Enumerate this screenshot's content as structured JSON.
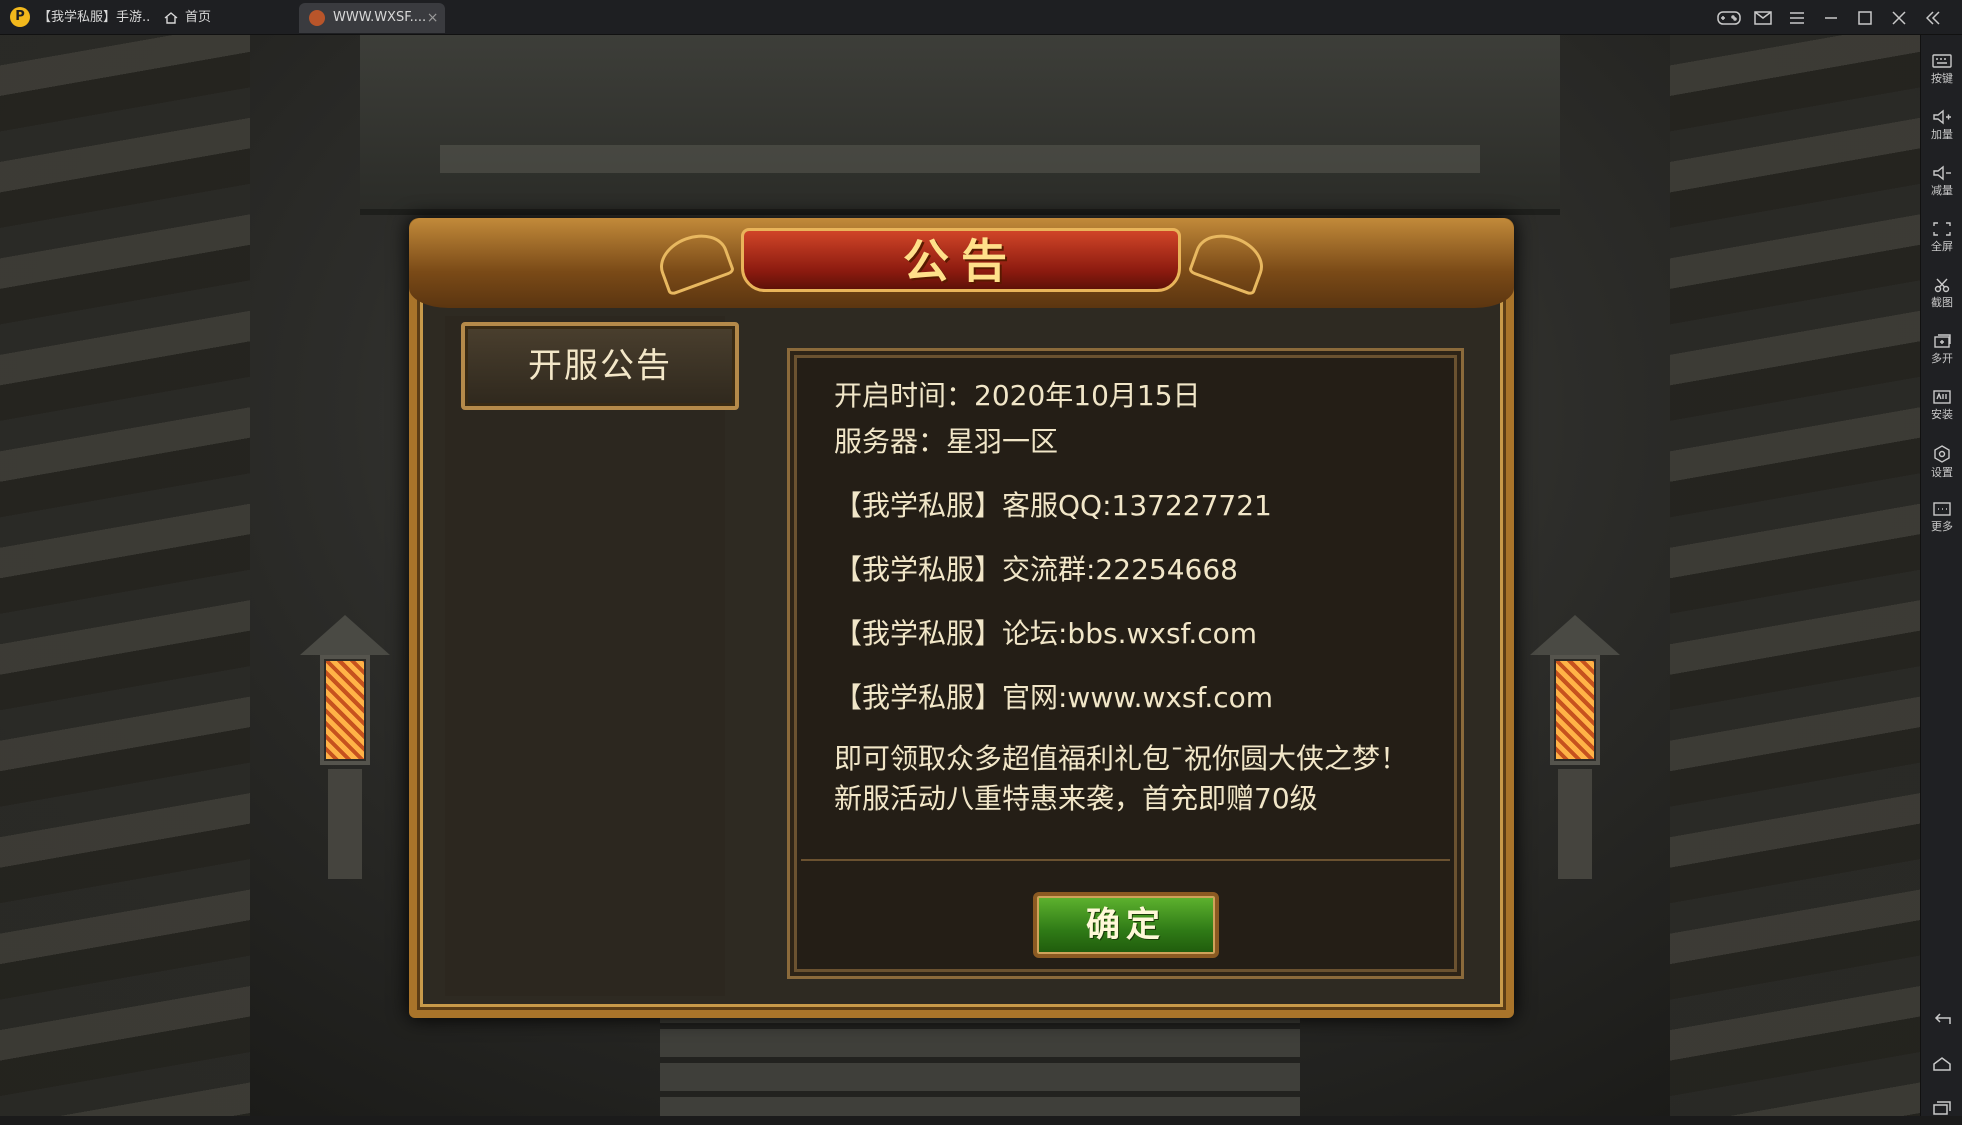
{
  "titlebar": {
    "tabs": [
      {
        "label": "【我学私服】手游...",
        "active": false
      },
      {
        "label": "首页",
        "active": false
      },
      {
        "label": "WWW.WXSF....",
        "active": true
      }
    ],
    "close_glyph": "×"
  },
  "dialog": {
    "title": "公告",
    "category_button": "开服公告",
    "content": {
      "open_time": "开启时间：2020年10月15日",
      "server": "服务器：星羽一区",
      "qq": "【我学私服】客服QQ:137227721",
      "group": "【我学私服】交流群:22254668",
      "forum": "【我学私服】论坛:bbs.wxsf.com",
      "website": "【我学私服】官网:www.wxsf.com",
      "promo": "即可领取众多超值福利礼包¯祝你圆大侠之梦！新服活动八重特惠来袭，首充即赠70级"
    },
    "confirm_button": "确定"
  },
  "sidebar": {
    "items": [
      {
        "label": "按键",
        "icon": "keyboard-icon"
      },
      {
        "label": "加量",
        "icon": "volume-up-icon"
      },
      {
        "label": "减量",
        "icon": "volume-down-icon"
      },
      {
        "label": "全屏",
        "icon": "fullscreen-icon"
      },
      {
        "label": "截图",
        "icon": "scissors-icon"
      },
      {
        "label": "多开",
        "icon": "multi-instance-icon"
      },
      {
        "label": "安装",
        "icon": "apk-install-icon"
      },
      {
        "label": "设置",
        "icon": "gear-icon"
      },
      {
        "label": "更多",
        "icon": "more-icon"
      }
    ],
    "bottom_icons": [
      "back-icon",
      "home-icon",
      "recent-apps-icon"
    ]
  },
  "colors": {
    "dialog_border": "#a9742a",
    "title_plate": "#8b1a0f",
    "confirm_button": "#3a8c1e",
    "text": "#f1e6c8"
  }
}
